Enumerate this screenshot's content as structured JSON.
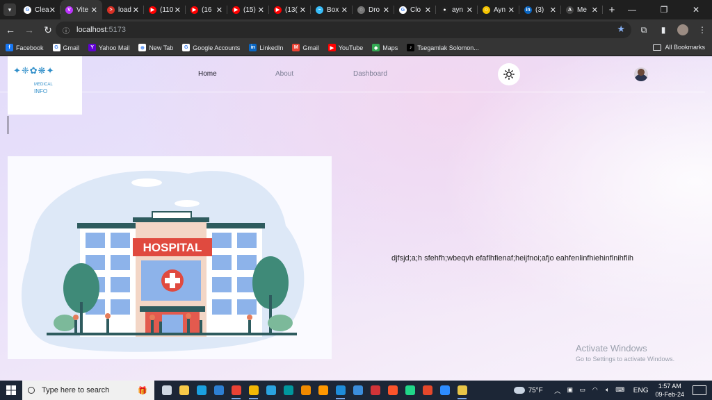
{
  "browser": {
    "tabs": [
      {
        "title": "Clea",
        "fav": "chrome-icon",
        "color": "#ffffff",
        "glyph": "G"
      },
      {
        "title": "Vite",
        "fav": "vite-icon",
        "color": "#bd34fe",
        "glyph": "V",
        "active": true
      },
      {
        "title": "load",
        "fav": "chevron-icon",
        "color": "#d93025",
        "glyph": ">"
      },
      {
        "title": "(110",
        "fav": "youtube-icon",
        "color": "#ff0000",
        "glyph": "▶"
      },
      {
        "title": "(16",
        "fav": "youtube-icon",
        "color": "#ff0000",
        "glyph": "▶"
      },
      {
        "title": "(15)",
        "fav": "youtube-icon",
        "color": "#ff0000",
        "glyph": "▶"
      },
      {
        "title": "(13(",
        "fav": "youtube-icon",
        "color": "#ff0000",
        "glyph": "▶"
      },
      {
        "title": "Box",
        "fav": "tailwind-icon",
        "color": "#38bdf8",
        "glyph": "~"
      },
      {
        "title": "Dro",
        "fav": "dashed-circle-icon",
        "color": "#777777",
        "glyph": "◌"
      },
      {
        "title": "Clo",
        "fav": "chrome-icon",
        "color": "#ffffff",
        "glyph": "G"
      },
      {
        "title": "ayn",
        "fav": "github-icon",
        "color": "#222222",
        "glyph": "●"
      },
      {
        "title": "Ayn",
        "fav": "emoji-icon",
        "color": "#f5c400",
        "glyph": "☺"
      },
      {
        "title": "(3)",
        "fav": "linkedin-icon",
        "color": "#0a66c2",
        "glyph": "in"
      },
      {
        "title": "Me",
        "fav": "anthropic-icon",
        "color": "#444444",
        "glyph": "A"
      }
    ],
    "url_host": "localhost",
    "url_port": ":5173",
    "bookmarks": [
      {
        "label": "Facebook",
        "color": "#1877f2",
        "glyph": "f"
      },
      {
        "label": "Gmail",
        "color": "#ffffff",
        "glyph": "G"
      },
      {
        "label": "Yahoo Mail",
        "color": "#6001d2",
        "glyph": "Y"
      },
      {
        "label": "New Tab",
        "color": "#ffffff",
        "glyph": "⊕"
      },
      {
        "label": "Google Accounts",
        "color": "#ffffff",
        "glyph": "G"
      },
      {
        "label": "LinkedIn",
        "color": "#0a66c2",
        "glyph": "in"
      },
      {
        "label": "Gmail",
        "color": "#ea4335",
        "glyph": "M"
      },
      {
        "label": "YouTube",
        "color": "#ff0000",
        "glyph": "▶"
      },
      {
        "label": "Maps",
        "color": "#34a853",
        "glyph": "◆"
      },
      {
        "label": "Tsegamlak Solomon...",
        "color": "#000000",
        "glyph": "♪"
      }
    ],
    "all_bookmarks": "All Bookmarks"
  },
  "app": {
    "logo_mid": "MEDICAL",
    "logo_sub": "INFO",
    "nav": {
      "home": "Home",
      "about": "About",
      "dashboard": "Dashboard"
    },
    "hero_sign": "HOSPITAL",
    "hero_text": "djfsjd;a;h sfehfh;wbeqvh efaflhfienaf;heijfnoi;afjo eahfenlinfhiehinflnihflih"
  },
  "watermark": {
    "title": "Activate Windows",
    "subtitle": "Go to Settings to activate Windows."
  },
  "taskbar": {
    "search_placeholder": "Type here to search",
    "apps": [
      {
        "name": "task-view-icon",
        "color": "#cfd8e3"
      },
      {
        "name": "file-explorer-icon",
        "color": "#f7c948"
      },
      {
        "name": "edge-icon",
        "color": "#1aa0e0"
      },
      {
        "name": "store-icon",
        "color": "#2d7fd3"
      },
      {
        "name": "chrome-icon",
        "color": "#e94235",
        "open": true
      },
      {
        "name": "chrome-profile-icon",
        "color": "#f2b705",
        "open": true
      },
      {
        "name": "telegram-icon",
        "color": "#2aa3df"
      },
      {
        "name": "arduino-icon",
        "color": "#00979d"
      },
      {
        "name": "vlc-icon",
        "color": "#f08a00"
      },
      {
        "name": "sublime-icon",
        "color": "#ff9800"
      },
      {
        "name": "vscode-icon",
        "color": "#1e8cd8",
        "open": true
      },
      {
        "name": "screen-share-icon",
        "color": "#3b8ddb"
      },
      {
        "name": "media-icon",
        "color": "#d13438"
      },
      {
        "name": "brave-icon",
        "color": "#fb542b"
      },
      {
        "name": "pycharm-icon",
        "color": "#21d789"
      },
      {
        "name": "lens-icon",
        "color": "#e5482b"
      },
      {
        "name": "zoom-icon",
        "color": "#2d8cff"
      },
      {
        "name": "sticky-icon",
        "color": "#e8c547",
        "open": true
      }
    ],
    "temperature": "75°F",
    "language": "ENG",
    "time": "1:57 AM",
    "date": "09-Feb-24"
  }
}
